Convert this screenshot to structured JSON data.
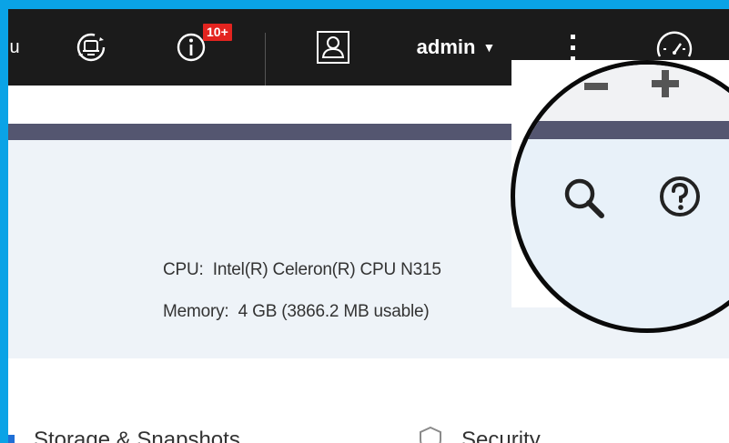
{
  "topbar": {
    "nav_fragment": "u",
    "notification_badge": "10+",
    "user_label": "admin",
    "icons": {
      "sync": "sync-icon",
      "info": "info-icon",
      "user": "user-icon",
      "more": "more-vertical-icon",
      "gauge": "gauge-icon"
    }
  },
  "system_info": {
    "cpu_label": "CPU:",
    "cpu_value": "Intel(R) Celeron(R) CPU N315",
    "memory_label": "Memory:",
    "memory_value": "4 GB (3866.2 MB usable)"
  },
  "apps": [
    {
      "label": "Storage & Snapshots",
      "icon": "storage-icon"
    },
    {
      "label": "Security",
      "icon": "shield-icon"
    }
  ],
  "magnifier": {
    "icons": [
      "minus-icon",
      "plus-icon",
      "search-icon",
      "help-icon"
    ]
  },
  "colors": {
    "outer_border": "#0aa3e6",
    "topbar": "#1b1b1b",
    "stripe": "#545670",
    "panel": "#eef3f8",
    "badge": "#e3241f"
  }
}
